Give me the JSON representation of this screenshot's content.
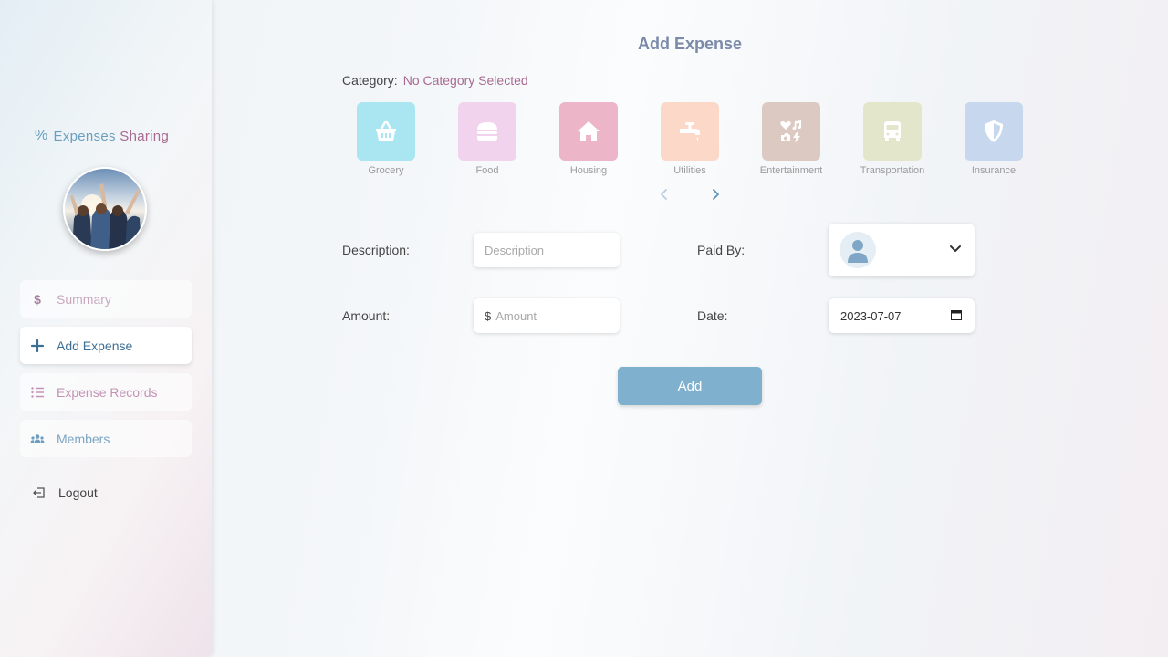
{
  "brand": {
    "symbol": "%",
    "word1": "Expenses",
    "word2": "Sharing"
  },
  "nav": {
    "summary": {
      "label": "Summary",
      "icon": "dollar-icon",
      "color": "#a97f9e"
    },
    "add_expense": {
      "label": "Add Expense",
      "icon": "plus-icon",
      "color": "#3d6f95"
    },
    "expense_records": {
      "label": "Expense Records",
      "icon": "list-icon",
      "color": "#c493b5"
    },
    "members": {
      "label": "Members",
      "icon": "users-icon",
      "color": "#6e9dc0"
    },
    "logout": {
      "label": "Logout",
      "icon": "logout-icon"
    }
  },
  "page": {
    "title": "Add Expense"
  },
  "category": {
    "label": "Category:",
    "value": "No Category Selected"
  },
  "categories": [
    {
      "name": "Grocery",
      "icon": "basket-icon",
      "color": "#a9e6f2"
    },
    {
      "name": "Food",
      "icon": "burger-icon",
      "color": "#f1d3ee"
    },
    {
      "name": "Housing",
      "icon": "house-icon",
      "color": "#ecb6c8"
    },
    {
      "name": "Utilities",
      "icon": "faucet-icon",
      "color": "#fbd8c8"
    },
    {
      "name": "Entertainment",
      "icon": "entertainment-icon",
      "color": "#dccac2"
    },
    {
      "name": "Transportation",
      "icon": "bus-icon",
      "color": "#e3e6cb"
    },
    {
      "name": "Insurance",
      "icon": "shield-icon",
      "color": "#c7d8ee"
    }
  ],
  "form": {
    "description": {
      "label": "Description:",
      "placeholder": "Description"
    },
    "paid_by": {
      "label": "Paid By:"
    },
    "amount": {
      "label": "Amount:",
      "prefix": "$",
      "placeholder": "Amount"
    },
    "date": {
      "label": "Date:",
      "value": "2023-07-07"
    }
  },
  "add_button": {
    "label": "Add"
  }
}
